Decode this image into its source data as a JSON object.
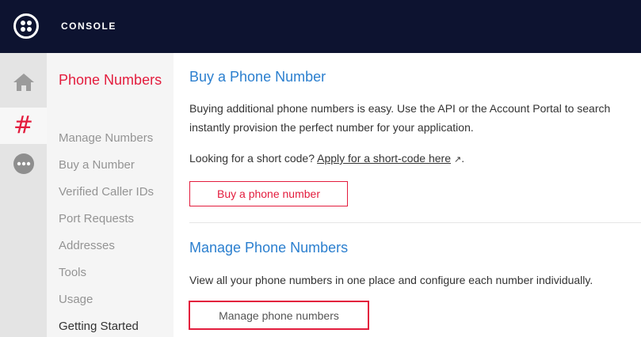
{
  "header": {
    "brand": "CONSOLE"
  },
  "rail": {
    "hash_symbol": "#"
  },
  "sidebar": {
    "title": "Phone Numbers",
    "items": [
      {
        "label": "Manage Numbers"
      },
      {
        "label": "Buy a Number"
      },
      {
        "label": "Verified Caller IDs"
      },
      {
        "label": "Port Requests"
      },
      {
        "label": "Addresses"
      },
      {
        "label": "Tools"
      },
      {
        "label": "Usage"
      },
      {
        "label": "Getting Started"
      }
    ]
  },
  "buy_section": {
    "title": "Buy a Phone Number",
    "description_line1": "Buying additional phone numbers is easy. Use the API or the Account Portal to search",
    "description_line2": "instantly provision the perfect number for your application.",
    "short_code_prefix": "Looking for a short code? ",
    "short_code_link": "Apply for a short-code here",
    "short_code_ext_icon": "↗",
    "short_code_suffix": ".",
    "button_label": "Buy a phone number"
  },
  "manage_section": {
    "title": "Manage Phone Numbers",
    "description": "View all your phone numbers in one place and configure each number individually.",
    "button_label": "Manage phone numbers"
  },
  "colors": {
    "topbar": "#0d1330",
    "accent_red": "#e31c3d",
    "heading_blue": "#2b7fcf",
    "sidebar_muted": "#949494"
  }
}
